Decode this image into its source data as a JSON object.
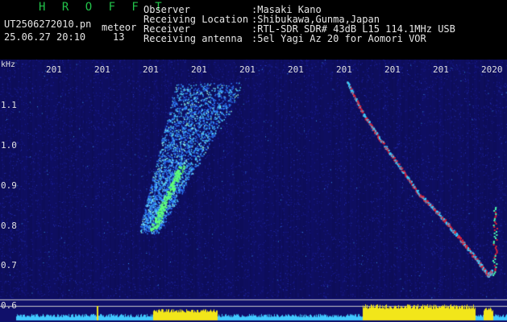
{
  "header": {
    "logo": "H R O F F T",
    "filename": "UT2506272010.pn",
    "meteor_label": "meteor",
    "timestamp": "25.06.27 20:10",
    "count": "13",
    "fields": [
      {
        "label": "Observer",
        "value": ":Masaki Kano"
      },
      {
        "label": "Receiving Location",
        "value": ":Shibukawa,Gunma,Japan"
      },
      {
        "label": "Receiver",
        "value": ":RTL-SDR SDR# 43dB L15 114.1MHz USB"
      },
      {
        "label": "Receiving antenna",
        "value": ":5el Yagi Az 20 for Aomori VOR"
      }
    ]
  },
  "chart_data": {
    "type": "heatmap",
    "ylabel": "kHz",
    "y_ticks": [
      "1.1",
      "1.0",
      "0.9",
      "0.8",
      "0.7",
      "0.6"
    ],
    "x_ticks": [
      "201",
      "201",
      "201",
      "201",
      "201",
      "201",
      "201",
      "201",
      "201",
      "2020"
    ],
    "ylim": [
      0.58,
      1.16
    ],
    "background_color": "#10106a",
    "trace_color": "#e0223a",
    "meteor_color": "#50d8ff",
    "bottom_bar_color": "#f2e61a",
    "bottom_line_color": "#40c8ff"
  }
}
